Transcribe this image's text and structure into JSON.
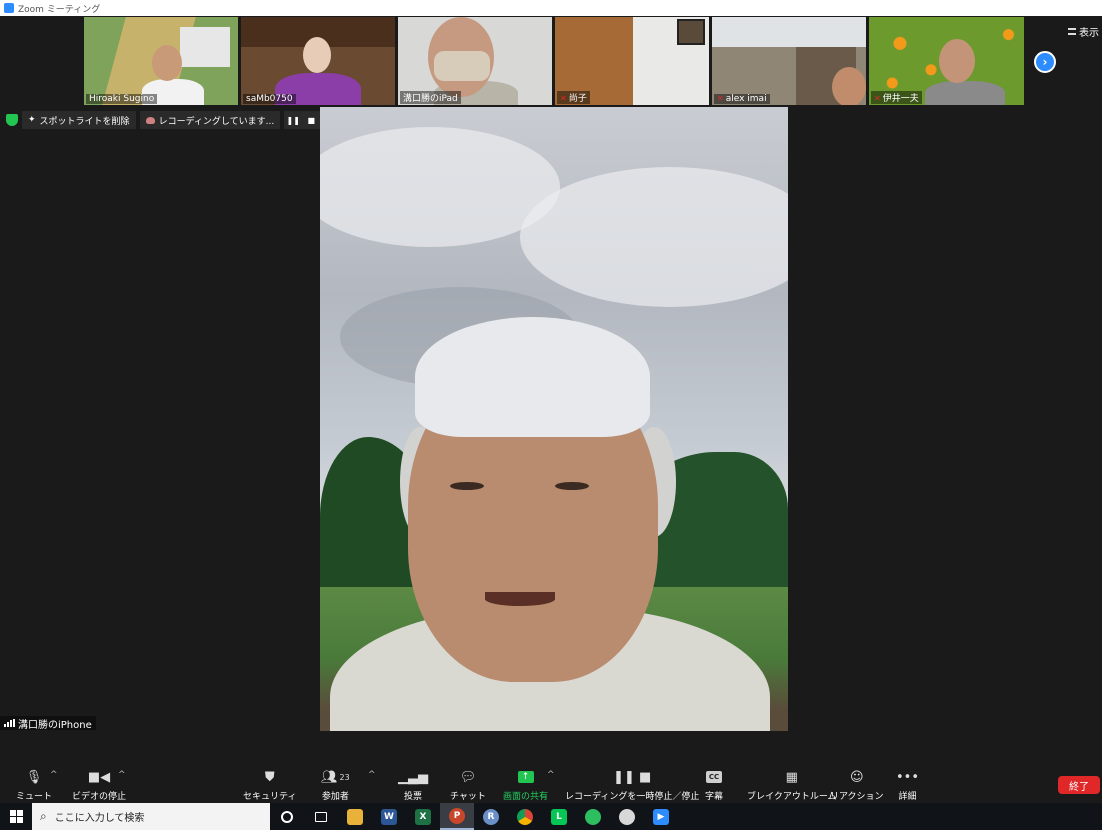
{
  "window": {
    "title": "Zoom ミーティング"
  },
  "thumbnails": [
    {
      "name": "Hiroaki Sugino",
      "muted": false,
      "bg": "#7fa35a"
    },
    {
      "name": "saMb0750",
      "muted": false,
      "bg": "#6a4a30"
    },
    {
      "name": "溝口勝のiPad",
      "muted": false,
      "bg": "#d8d8d6"
    },
    {
      "name": "尚子",
      "muted": true,
      "bg": "#a56a35"
    },
    {
      "name": "alex imai",
      "muted": true,
      "bg": "#8f8676"
    },
    {
      "name": "伊井一夫",
      "muted": true,
      "bg": "#6c9a2c"
    }
  ],
  "view_label": "表示",
  "status_bar": {
    "spotlight_label": "スポットライトを削除",
    "recording_label": "レコーディングしています..."
  },
  "main_video": {
    "name": "溝口勝のiPhone"
  },
  "toolbar": {
    "mute": "ミュート",
    "video": "ビデオの停止",
    "security": "セキュリティ",
    "participants": "参加者",
    "participants_count": "23",
    "polls": "投票",
    "chat": "チャット",
    "share": "画面の共有",
    "recording": "レコーディングを一時停止／停止",
    "captions": "字幕",
    "breakout": "ブレイクアウトルーム",
    "reactions": "リアクション",
    "more": "詳細",
    "end": "終了"
  },
  "taskbar": {
    "search_placeholder": "ここに入力して検索"
  },
  "colors": {
    "accent": "#2d8cff",
    "share_green": "#23c552",
    "end_red": "#e02828"
  }
}
